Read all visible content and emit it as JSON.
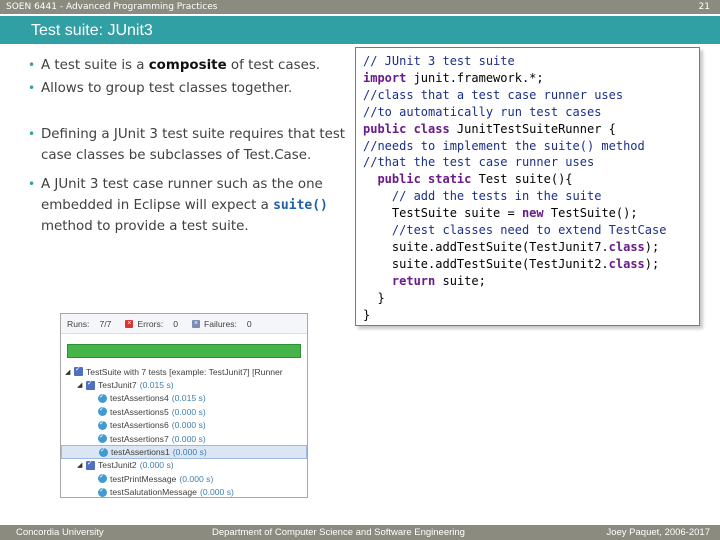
{
  "header": {
    "course": "SOEN 6441 - Advanced Programming Practices",
    "page_number": "21"
  },
  "slide": {
    "title": "Test suite: JUnit3"
  },
  "bullets": [
    {
      "pre": "A test suite is a ",
      "bold": "composite",
      "post": " of test cases."
    },
    {
      "text": "Allows to group test classes together."
    },
    {
      "text": "Defining a JUnit 3 test suite requires that test case classes be subclasses of Test.Case."
    },
    {
      "pre": "A JUnit 3 test case runner such as the one embedded in Eclipse will expect a ",
      "code": "suite()",
      "post": " method to provide a test suite."
    }
  ],
  "code_lines": [
    {
      "indent": "",
      "parts": [
        {
          "t": "// JUnit 3 test suite",
          "c": "cm"
        }
      ]
    },
    {
      "indent": "",
      "parts": [
        {
          "t": "import",
          "c": "kw"
        },
        {
          "t": " junit.framework.*;",
          "c": ""
        }
      ]
    },
    {
      "indent": "",
      "parts": [
        {
          "t": "//class that a test case runner uses",
          "c": "cm"
        }
      ]
    },
    {
      "indent": "",
      "parts": [
        {
          "t": "//to automatically run test cases",
          "c": "cm"
        }
      ]
    },
    {
      "indent": "",
      "parts": [
        {
          "t": "public class",
          "c": "kw"
        },
        {
          "t": " JunitTestSuiteRunner {",
          "c": ""
        }
      ]
    },
    {
      "indent": "",
      "parts": [
        {
          "t": "//needs to implement the suite() method",
          "c": "cm"
        }
      ]
    },
    {
      "indent": "",
      "parts": [
        {
          "t": "//that the test case runner uses",
          "c": "cm"
        }
      ]
    },
    {
      "indent": "  ",
      "parts": [
        {
          "t": "public static",
          "c": "kw"
        },
        {
          "t": " Test suite(){",
          "c": ""
        }
      ]
    },
    {
      "indent": "    ",
      "parts": [
        {
          "t": "// add the tests in the suite",
          "c": "cm"
        }
      ]
    },
    {
      "indent": "    ",
      "parts": [
        {
          "t": "TestSuite suite = ",
          "c": ""
        },
        {
          "t": "new",
          "c": "kw"
        },
        {
          "t": " TestSuite();",
          "c": ""
        }
      ]
    },
    {
      "indent": "    ",
      "parts": [
        {
          "t": "//test classes need to extend TestCase",
          "c": "cm"
        }
      ]
    },
    {
      "indent": "    ",
      "parts": [
        {
          "t": "suite.addTestSuite(TestJunit7.",
          "c": ""
        },
        {
          "t": "class",
          "c": "kw"
        },
        {
          "t": ");",
          "c": ""
        }
      ]
    },
    {
      "indent": "    ",
      "parts": [
        {
          "t": "suite.addTestSuite(TestJunit2.",
          "c": ""
        },
        {
          "t": "class",
          "c": "kw"
        },
        {
          "t": ");",
          "c": ""
        }
      ]
    },
    {
      "indent": "    ",
      "parts": [
        {
          "t": "return",
          "c": "kw"
        },
        {
          "t": " suite;",
          "c": ""
        }
      ]
    },
    {
      "indent": "  ",
      "parts": [
        {
          "t": "}",
          "c": ""
        }
      ]
    },
    {
      "indent": "",
      "parts": [
        {
          "t": "}",
          "c": ""
        }
      ]
    }
  ],
  "junit": {
    "runs_label": "Runs:",
    "runs_value": "7/7",
    "errors_label": "Errors:",
    "errors_value": "0",
    "failures_label": "Failures:",
    "failures_value": "0",
    "progress_fraction": 1.0,
    "tree": [
      {
        "level": 0,
        "kind": "suite",
        "name": "TestSuite with 7 tests [example: TestJunit7] [Runner",
        "time": "",
        "expanded": true
      },
      {
        "level": 1,
        "kind": "suite",
        "name": "TestJunit7",
        "time": "(0.015 s)",
        "expanded": true
      },
      {
        "level": 2,
        "kind": "test",
        "name": "testAssertions4",
        "time": "(0.015 s)"
      },
      {
        "level": 2,
        "kind": "test",
        "name": "testAssertions5",
        "time": "(0.000 s)"
      },
      {
        "level": 2,
        "kind": "test",
        "name": "testAssertions6",
        "time": "(0.000 s)"
      },
      {
        "level": 2,
        "kind": "test",
        "name": "testAssertions7",
        "time": "(0.000 s)"
      },
      {
        "level": 2,
        "kind": "test",
        "name": "testAssertions1",
        "time": "(0.000 s)",
        "selected": true
      },
      {
        "level": 1,
        "kind": "suite",
        "name": "TestJunit2",
        "time": "(0.000 s)",
        "expanded": true
      },
      {
        "level": 2,
        "kind": "test",
        "name": "testPrintMessage",
        "time": "(0.000 s)"
      },
      {
        "level": 2,
        "kind": "test",
        "name": "testSalutationMessage",
        "time": "(0.000 s)"
      }
    ]
  },
  "footer": {
    "left": "Concordia University",
    "center": "Department of Computer Science and Software Engineering",
    "right": "Joey Paquet, 2006-2017"
  }
}
